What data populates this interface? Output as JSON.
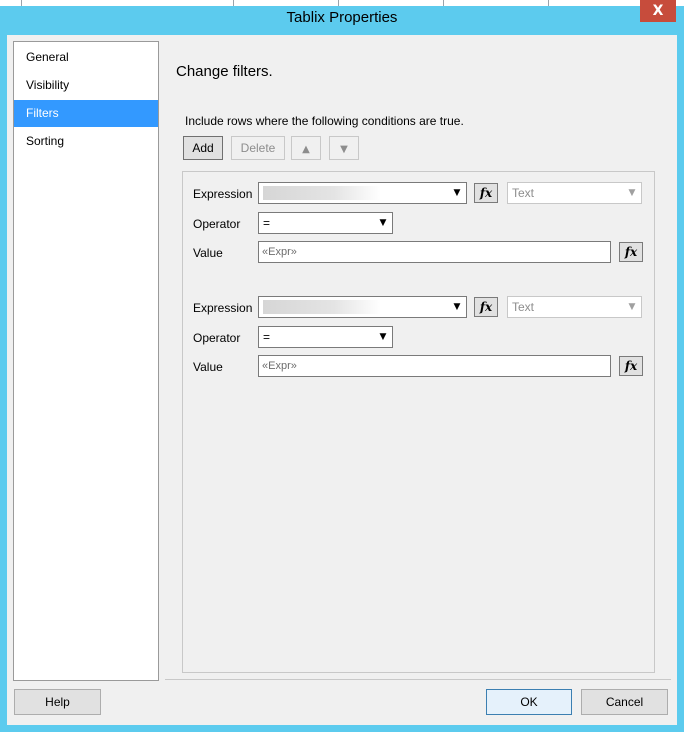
{
  "window": {
    "title": "Tablix Properties",
    "close_label": "X"
  },
  "nav": {
    "items": [
      {
        "label": "General",
        "selected": false
      },
      {
        "label": "Visibility",
        "selected": false
      },
      {
        "label": "Filters",
        "selected": true
      },
      {
        "label": "Sorting",
        "selected": false
      }
    ]
  },
  "page": {
    "heading": "Change filters.",
    "instruction": "Include rows where the following conditions are true.",
    "toolbar": {
      "add_label": "Add",
      "delete_label": "Delete",
      "up_glyph": "▲",
      "down_glyph": "▼"
    },
    "filters": [
      {
        "expression_label": "Expression",
        "type_value": "Text",
        "operator_label": "Operator",
        "operator_value": "=",
        "value_label": "Value",
        "value_text": "«Expr»",
        "fx_label": "fx"
      },
      {
        "expression_label": "Expression",
        "type_value": "Text",
        "operator_label": "Operator",
        "operator_value": "=",
        "value_label": "Value",
        "value_text": "«Expr»",
        "fx_label": "fx"
      }
    ]
  },
  "footer": {
    "help_label": "Help",
    "ok_label": "OK",
    "cancel_label": "Cancel"
  },
  "colors": {
    "frame": "#5ccbee",
    "selection": "#3399ff",
    "close": "#c74c3c"
  }
}
